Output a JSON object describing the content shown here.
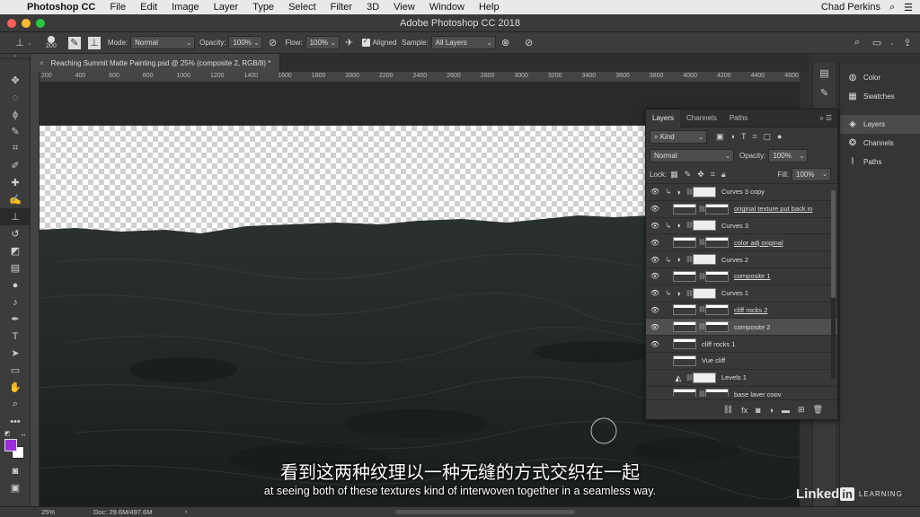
{
  "menubar": {
    "app_name": "Photoshop CC",
    "items": [
      "File",
      "Edit",
      "Image",
      "Layer",
      "Type",
      "Select",
      "Filter",
      "3D",
      "View",
      "Window",
      "Help"
    ],
    "user": "Chad Perkins"
  },
  "window": {
    "title": "Adobe Photoshop CC 2018"
  },
  "options_bar": {
    "brush_size": "200",
    "mode_label": "Mode:",
    "mode_value": "Normal",
    "opacity_label": "Opacity:",
    "opacity_value": "100%",
    "flow_label": "Flow:",
    "flow_value": "100%",
    "aligned_label": "Aligned",
    "sample_label": "Sample:",
    "sample_value": "All Layers"
  },
  "document": {
    "tab_title": "Reaching Summit Matte Painting.psd @ 25% (composite 2, RGB/8) *",
    "ruler_ticks": [
      "200",
      "400",
      "600",
      "800",
      "1000",
      "1200",
      "1400",
      "1600",
      "1800",
      "2000",
      "2200",
      "2400",
      "2600",
      "2800",
      "3000",
      "3200",
      "3400",
      "3600",
      "3800",
      "4000",
      "4200",
      "4400",
      "4600"
    ]
  },
  "dock": {
    "items": [
      {
        "label": "Color",
        "icon": "color-wheel-icon"
      },
      {
        "label": "Swatches",
        "icon": "swatches-grid-icon"
      },
      {
        "label": "Layers",
        "icon": "layers-stack-icon"
      },
      {
        "label": "Channels",
        "icon": "channels-icon"
      },
      {
        "label": "Paths",
        "icon": "paths-icon"
      }
    ]
  },
  "layers_panel": {
    "tabs": [
      "Layers",
      "Channels",
      "Paths"
    ],
    "filter_label": "Kind",
    "blend_mode": "Normal",
    "opacity_label": "Opacity:",
    "opacity_value": "100%",
    "lock_label": "Lock:",
    "fill_label": "Fill:",
    "fill_value": "100%",
    "layers": [
      {
        "name": "Curves 3 copy",
        "type": "adjustment",
        "visible": true,
        "clipped": true,
        "underline": false,
        "selected": false
      },
      {
        "name": "original texture put back in",
        "type": "masked",
        "visible": true,
        "clipped": false,
        "underline": true,
        "selected": false
      },
      {
        "name": "Curves 3",
        "type": "adjustment",
        "visible": true,
        "clipped": true,
        "underline": false,
        "selected": false
      },
      {
        "name": "color adj original",
        "type": "masked",
        "visible": true,
        "clipped": false,
        "underline": true,
        "selected": false
      },
      {
        "name": "Curves 2",
        "type": "adjustment",
        "visible": true,
        "clipped": true,
        "underline": false,
        "selected": false
      },
      {
        "name": "composite 1",
        "type": "masked",
        "visible": true,
        "clipped": false,
        "underline": true,
        "selected": false
      },
      {
        "name": "Curves 1",
        "type": "adjustment",
        "visible": true,
        "clipped": true,
        "underline": false,
        "selected": false
      },
      {
        "name": "cliff rocks 2",
        "type": "masked",
        "visible": true,
        "clipped": false,
        "underline": true,
        "selected": false
      },
      {
        "name": "composite 2",
        "type": "masked",
        "visible": true,
        "clipped": false,
        "underline": false,
        "selected": true
      },
      {
        "name": "cliff rocks 1",
        "type": "pixel",
        "visible": true,
        "clipped": false,
        "underline": false,
        "selected": false
      },
      {
        "name": "Vue cliff",
        "type": "pixel",
        "visible": false,
        "clipped": false,
        "underline": false,
        "selected": false
      },
      {
        "name": "Levels 1",
        "type": "adjustment",
        "visible": false,
        "clipped": false,
        "underline": false,
        "selected": false
      },
      {
        "name": "base layer copy",
        "type": "masked",
        "visible": false,
        "clipped": false,
        "underline": false,
        "selected": false
      }
    ]
  },
  "status": {
    "zoom": "25%",
    "doc_size": "Doc: 29.6M/497.6M"
  },
  "colors": {
    "foreground": "#9b30d9",
    "background": "#ffffff"
  },
  "subtitles": {
    "chinese": "看到这两种纹理以一种无缝的方式交织在一起",
    "english": "at seeing both of these textures kind of interwoven together in a seamless way."
  },
  "watermark": {
    "brand": "Linked",
    "brand_in": "in",
    "suffix": "LEARNING"
  }
}
